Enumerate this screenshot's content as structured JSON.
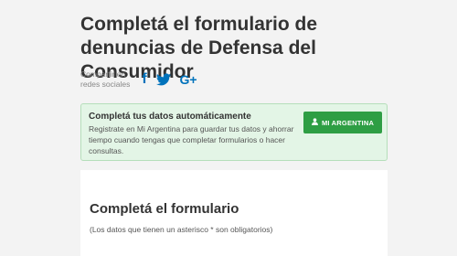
{
  "page": {
    "title": "Completá el formulario de denuncias de Defensa del Consumidor"
  },
  "share": {
    "label": "Compartir en redes sociales",
    "icons": [
      "facebook-icon",
      "twitter-icon",
      "google-plus-icon"
    ],
    "facebook_glyph": "f",
    "google_glyph": "G+",
    "color": "#0072bb"
  },
  "autofill": {
    "title": "Completá tus datos automáticamente",
    "text": "Registrate en Mi Argentina para guardar tus datos y ahorrar tiempo cuando tengas que completar formularios o hacer consultas.",
    "button_label": "MI ARGENTINA",
    "button_icon": "user-icon",
    "button_color": "#2e9e44",
    "background": "#e3f5e6"
  },
  "form": {
    "title": "Completá el formulario",
    "note": "(Los datos que tienen un asterisco * son obligatorios)"
  }
}
